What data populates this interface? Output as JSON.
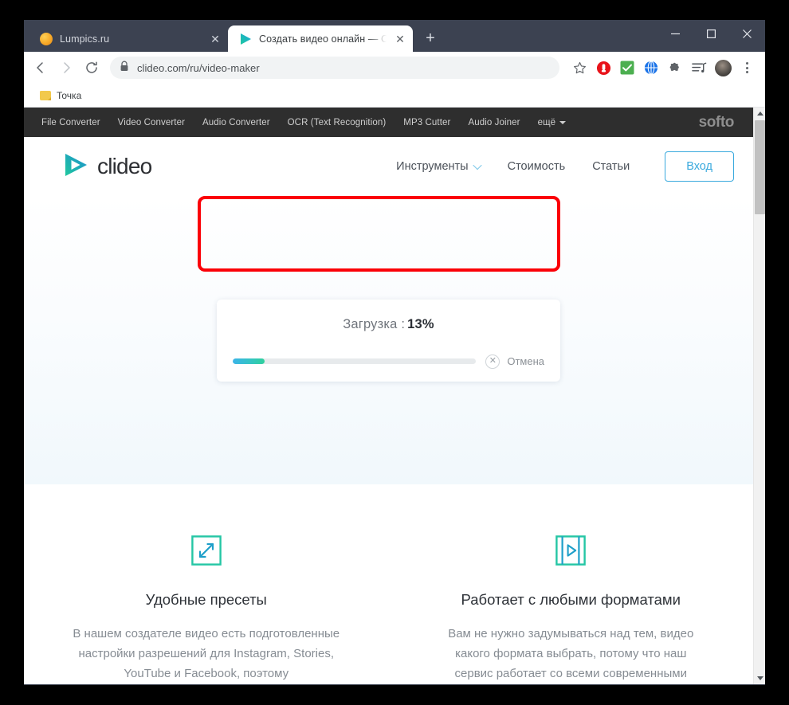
{
  "browser": {
    "tabs": [
      {
        "title": "Lumpics.ru",
        "favicon": "lumpics-favicon",
        "active": false
      },
      {
        "title": "Создать видео онлайн — Сдела",
        "favicon": "clideo-favicon",
        "active": true
      }
    ],
    "new_tab_label": "+",
    "window_controls": {
      "minimize": "—",
      "maximize": "□",
      "close": "✕"
    },
    "nav": {
      "back": "←",
      "forward": "→",
      "reload": "⟳"
    },
    "omnibox": {
      "url": "clideo.com/ru/video-maker",
      "lock_icon": "lock-icon"
    },
    "toolbar_icons": [
      "bookmark-star-icon",
      "adblock-icon",
      "checkmark-extension-icon",
      "globe-extension-icon",
      "extensions-puzzle-icon",
      "playlist-icon",
      "profile-avatar"
    ],
    "bookmarks": [
      {
        "label": "Точка",
        "icon": "folder-icon"
      }
    ]
  },
  "softo_bar": {
    "links": [
      "File Converter",
      "Video Converter",
      "Audio Converter",
      "OCR (Text Recognition)",
      "MP3 Cutter",
      "Audio Joiner"
    ],
    "more_label": "ещё",
    "brand": "softo"
  },
  "site_header": {
    "logo_text": "clideo",
    "nav": [
      {
        "label": "Инструменты",
        "has_chevron": true
      },
      {
        "label": "Стоимость",
        "has_chevron": false
      },
      {
        "label": "Статьи",
        "has_chevron": false
      }
    ],
    "login_label": "Вход"
  },
  "upload": {
    "status_label": "Загрузка :",
    "percent_label": "13%",
    "progress_value": 13,
    "cancel_label": "Отмена",
    "cancel_icon": "close-circle-icon",
    "highlight_color": "#fb0007",
    "progress_gradient_from": "#3bb4e8",
    "progress_gradient_to": "#2fd09c"
  },
  "features": [
    {
      "icon": "resize-arrows-icon",
      "title": "Удобные пресеты",
      "text": "В нашем создателе видео есть подготовленные настройки разрешений для Instagram, Stories, YouTube и Facebook, поэтому"
    },
    {
      "icon": "video-frame-play-icon",
      "title": "Работает с любыми форматами",
      "text": "Вам не нужно задумываться над тем, видео какого формата выбрать, потому что наш сервис работает со всеми современными"
    }
  ],
  "scrollbar": {
    "up_arrow": "scroll-up-arrow",
    "down_arrow": "scroll-down-arrow"
  }
}
